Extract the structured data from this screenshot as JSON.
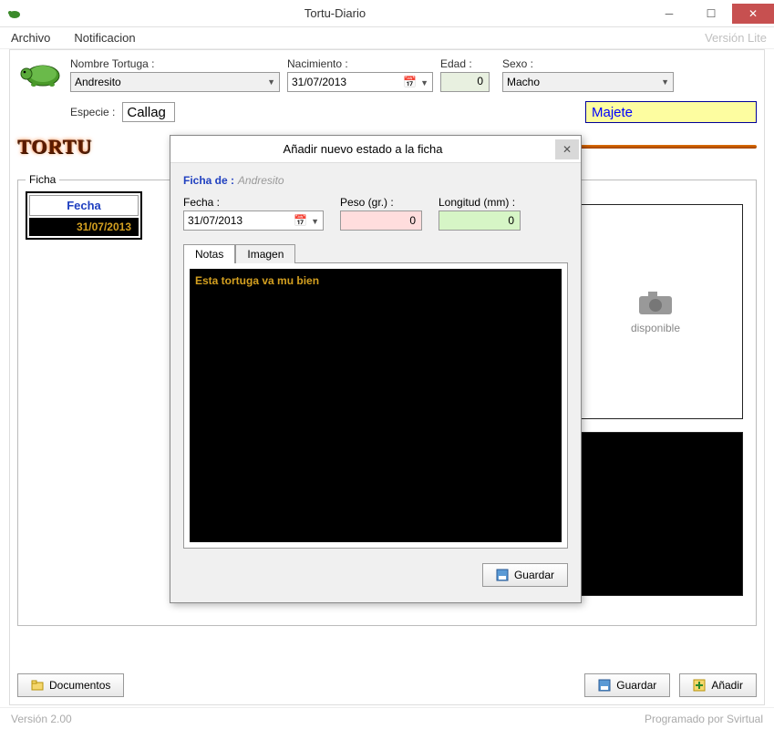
{
  "window": {
    "title": "Tortu-Diario"
  },
  "menu": {
    "archivo": "Archivo",
    "notificacion": "Notificacion",
    "version_lite": "Versión Lite"
  },
  "form": {
    "nombre_label": "Nombre Tortuga :",
    "nombre_value": "Andresito",
    "nacimiento_label": "Nacimiento :",
    "nacimiento_value": "31/07/2013",
    "edad_label": "Edad :",
    "edad_value": "0",
    "sexo_label": "Sexo :",
    "sexo_value": "Macho",
    "especie_label": "Especie :",
    "especie_value": "Callag",
    "majete_value": "Majete"
  },
  "logo": "TORTU",
  "ficha": {
    "legend": "Ficha",
    "col_fecha": "Fecha",
    "rows": [
      {
        "fecha": "31/07/2013"
      }
    ],
    "img_text": "disponible"
  },
  "buttons": {
    "documentos": "Documentos",
    "guardar": "Guardar",
    "anadir": "Añadir"
  },
  "status": {
    "version": "Versión 2.00",
    "credit": "Programado por Svirtual"
  },
  "dialog": {
    "title": "Añadir nuevo estado a la ficha",
    "ficha_de_label": "Ficha de :",
    "ficha_de_name": "Andresito",
    "fecha_label": "Fecha :",
    "fecha_value": "31/07/2013",
    "peso_label": "Peso (gr.) :",
    "peso_value": "0",
    "long_label": "Longitud (mm) :",
    "long_value": "0",
    "tab_notas": "Notas",
    "tab_imagen": "Imagen",
    "notes_text": "Esta tortuga va mu bien",
    "guardar": "Guardar"
  }
}
